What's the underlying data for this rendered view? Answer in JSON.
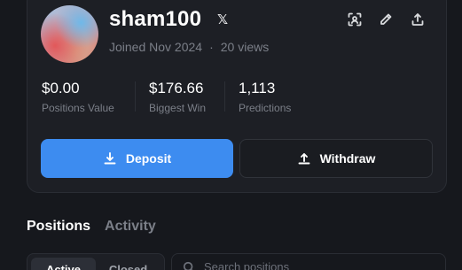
{
  "profile": {
    "username": "sham100",
    "x_icon_glyph": "𝕏",
    "joined": "Joined Nov 2024",
    "separator": "·",
    "views": "20 views",
    "icons": [
      "qr-scan-icon",
      "pencil-icon",
      "share-icon"
    ]
  },
  "stats": [
    {
      "value": "$0.00",
      "label": "Positions Value"
    },
    {
      "value": "$176.66",
      "label": "Biggest Win"
    },
    {
      "value": "1,113",
      "label": "Predictions"
    }
  ],
  "actions": {
    "deposit_label": "Deposit",
    "withdraw_label": "Withdraw",
    "deposit_icon": "download-icon",
    "withdraw_icon": "upload-icon"
  },
  "tabs": [
    {
      "label": "Positions",
      "active": true
    },
    {
      "label": "Activity",
      "active": false
    }
  ],
  "filter": {
    "segments": [
      {
        "label": "Active",
        "active": true
      },
      {
        "label": "Closed",
        "active": false
      }
    ],
    "search_placeholder": "Search positions"
  },
  "colors": {
    "accent": "#3d8cf0",
    "background": "#16181d",
    "card": "#1d1f25",
    "muted_text": "#7b7f88"
  }
}
